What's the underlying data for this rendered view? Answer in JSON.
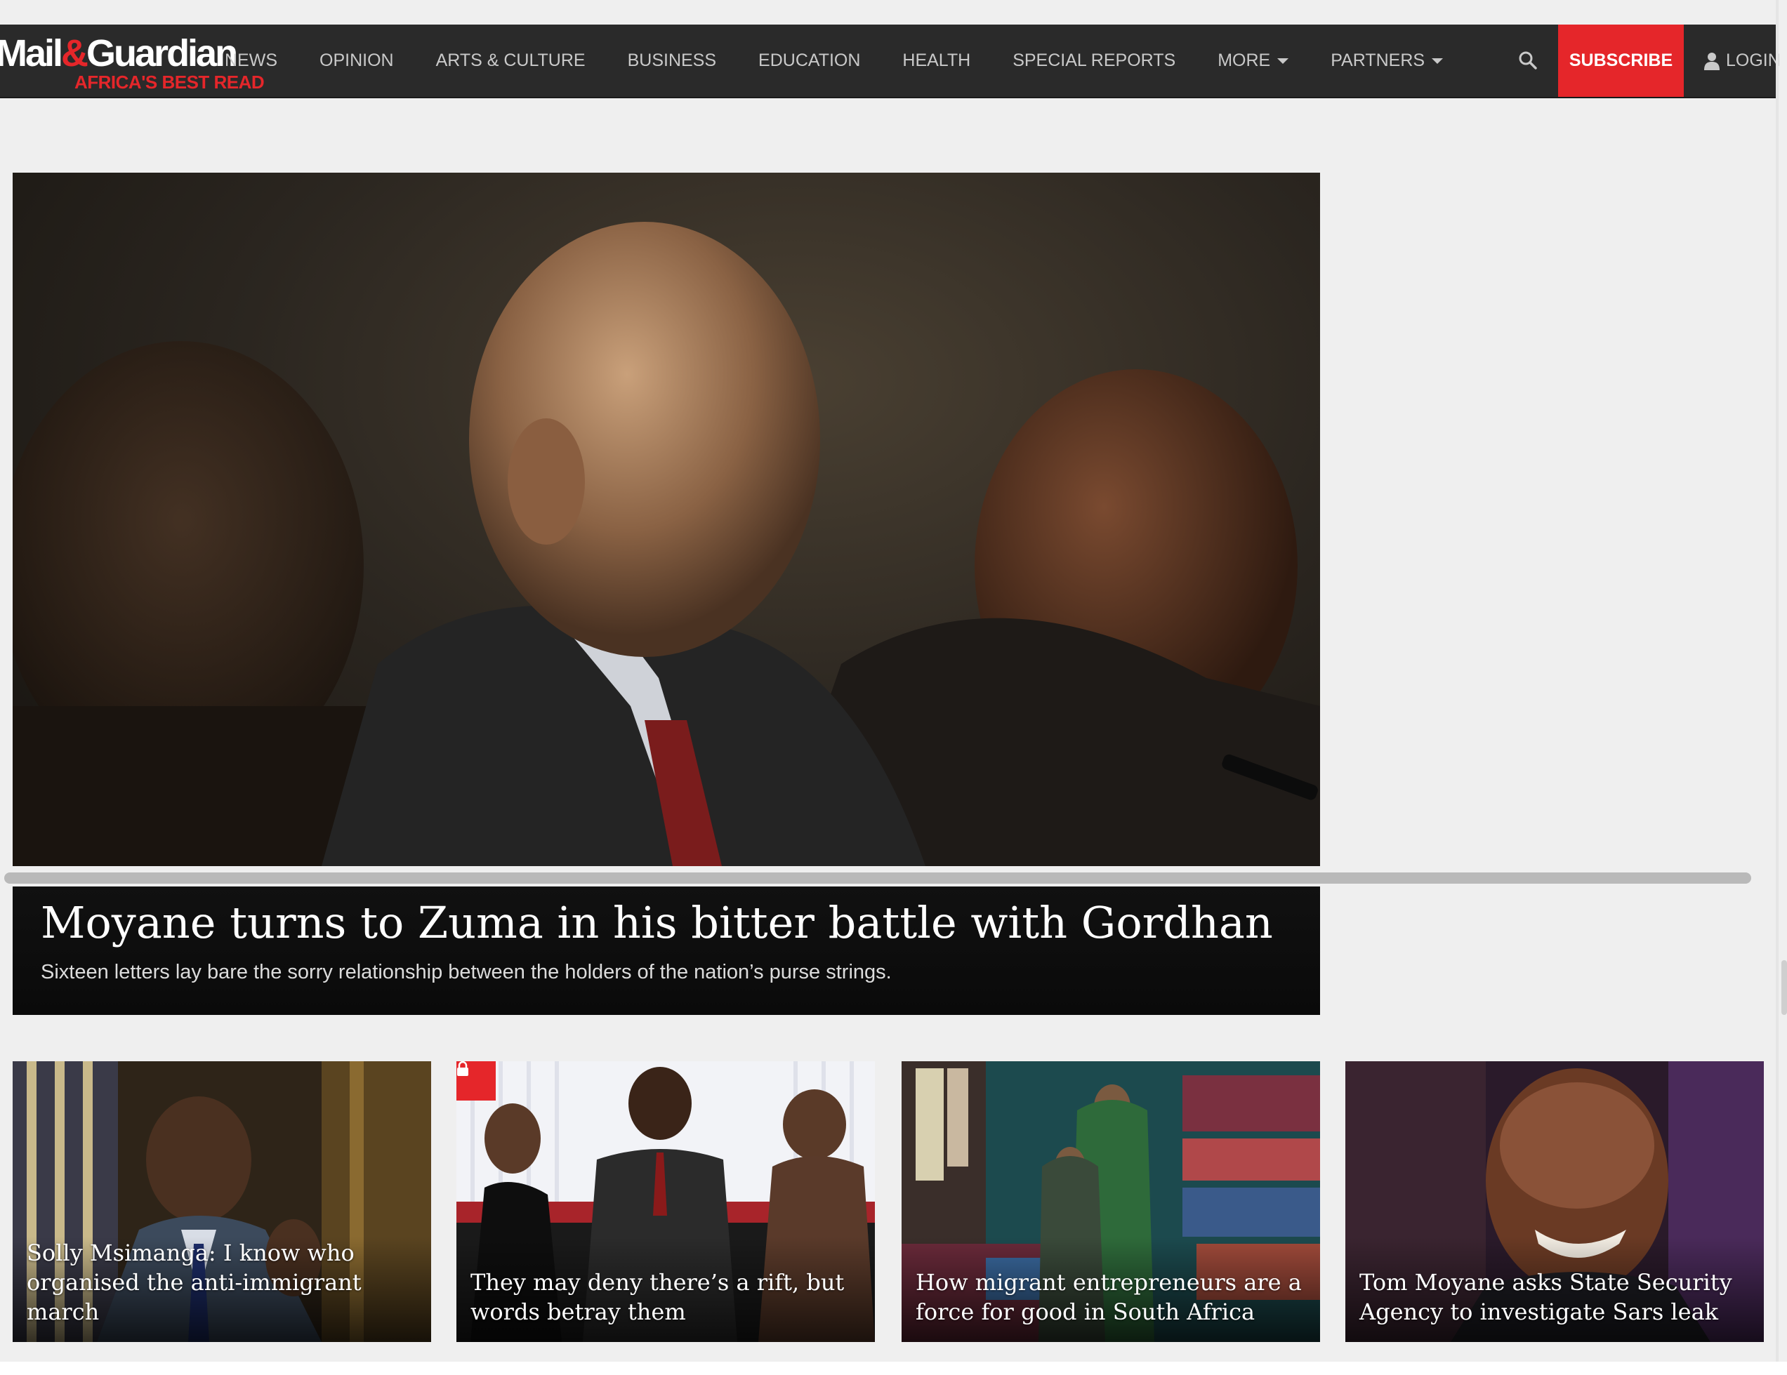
{
  "logo": {
    "main_pre": "Mail",
    "amp": "&",
    "main_post": "Guardian",
    "tagline": "AFRICA'S BEST READ"
  },
  "nav": {
    "items": [
      "NEWS",
      "OPINION",
      "ARTS & CULTURE",
      "BUSINESS",
      "EDUCATION",
      "HEALTH",
      "SPECIAL REPORTS"
    ],
    "more_label": "MORE",
    "partners_label": "PARTNERS",
    "subscribe_label": "SUBSCRIBE",
    "login_label": "LOGIN"
  },
  "hero": {
    "title": "Moyane turns to Zuma in his bitter battle with Gordhan",
    "subtitle": "Sixteen letters lay bare the sorry relationship between the holders of the nation’s purse strings."
  },
  "cards": [
    {
      "title": "Solly Msimanga: I know who organised the anti-immigrant march",
      "locked": false
    },
    {
      "title": "They may deny there’s a rift, but words betray them",
      "locked": true
    },
    {
      "title": "How migrant entrepreneurs are a force for good in South Africa",
      "locked": false
    },
    {
      "title": "Tom Moyane asks State Security Agency to investigate Sars leak",
      "locked": false
    }
  ],
  "colors": {
    "brand_red": "#e5262a",
    "nav_bg": "#2a2a2a",
    "page_bg": "#efefef"
  },
  "icons": {
    "search": "search-icon",
    "user": "user-icon",
    "lock": "lock-icon",
    "caret": "caret-down-icon"
  }
}
